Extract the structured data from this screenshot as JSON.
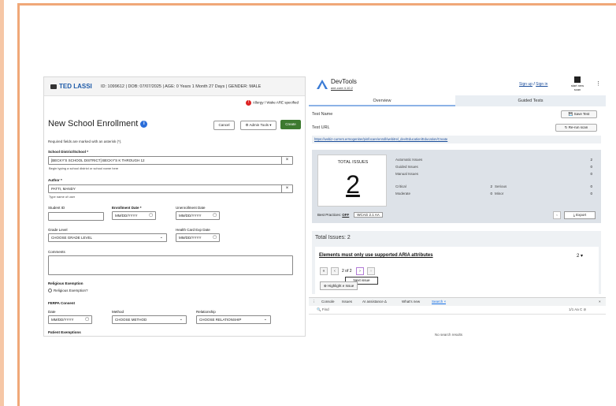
{
  "left": {
    "person_name": "TED LASSI",
    "meta": "ID: 1099612 | DOB: 07/07/2025 | AGE: 0 Years 1 Month 27 Days | GENDER: MALE",
    "allergy": "Allergy / Wake ARE specified",
    "form_title": "New School Enrollment",
    "cancel": "Cancel",
    "admin_tools": "⚙ Admin Tools ▾",
    "create": "Create",
    "required_note": "Required fields are marked with an asterisk (*).",
    "district_label": "School District/School *",
    "district_value": "[BECKY'S SCHOOL DISTRICT] BECKY'S K THROUGH 12",
    "district_hint": "Begin typing a school district or school name here",
    "author_label": "Author *",
    "author_value": "PATTI, MANDY",
    "author_hint": "Type name of user",
    "student_id_label": "Student ID",
    "enrollment_date_label": "Enrollment Date *",
    "unenrollment_date_label": "Unenrollment Date",
    "date_placeholder": "MM/DD/YYYY",
    "grade_label": "Grade Level",
    "grade_value": "CHOOSE GRADE LEVEL",
    "health_card_label": "Health Card Exp Date",
    "comments_label": "Comments",
    "religious_label": "Religious Exemption",
    "religious_option": "Religious Exemption?",
    "ferpa_label": "FERPA Consent",
    "date_label": "Date",
    "method_label": "Method",
    "method_value": "CHOOSE METHOD",
    "relationship_label": "Relationship",
    "relationship_value": "CHOOSE RELATIONSHIP",
    "patient_exemptions": "Patient Exemptions"
  },
  "right": {
    "title": "DevTools",
    "version": "axe-core 4.10.2",
    "sign_up": "Sign up",
    "sep": "/",
    "sign_in": "Sign in",
    "start_scan": "start new scan",
    "tab_overview": "Overview",
    "tab_guided": "Guided Tests",
    "test_name_label": "Test Name",
    "save_test": "💾 Save Test",
    "test_url_label": "Test URL",
    "rerun": "↻ Re-run scan",
    "url": "https://webiz-current.errnogeniter/pinfocare/enroll/webitrel_dev/Education/Education/Create",
    "total_issues_title": "TOTAL ISSUES",
    "total_issues_value": "2",
    "automatic_label": "Automatic Issues",
    "automatic_value": "2",
    "guided_label": "Guided Issues",
    "guided_value": "0",
    "manual_label": "Manual Issues",
    "manual_value": "0",
    "critical_label": "Critical",
    "critical_value": "2",
    "serious_label": "Serious",
    "serious_value": "0",
    "moderate_label": "Moderate",
    "moderate_value": "0",
    "minor_label": "Minor",
    "minor_value": "0",
    "best_practices": "Best Practices:",
    "best_practices_state": "OFF",
    "wcag": "WCAG 2.1 AA",
    "export": "⤓ Export",
    "total_issues_heading": "Total Issues: 2",
    "issue_title": "Elements must only use supported ARIA attributes",
    "issue_count": "2 ▾",
    "pager": "2 of 2",
    "tooltip": "Next issue",
    "highlight": "⊕ Highlight          e Issue",
    "console_tabs": [
      "Console",
      "Issues",
      "AI assistance ∆",
      "What's new",
      "Search ×"
    ],
    "find": "🔍 Find",
    "find_right": "1/1 Aa   C  ⊘",
    "no_results": "No search results"
  }
}
